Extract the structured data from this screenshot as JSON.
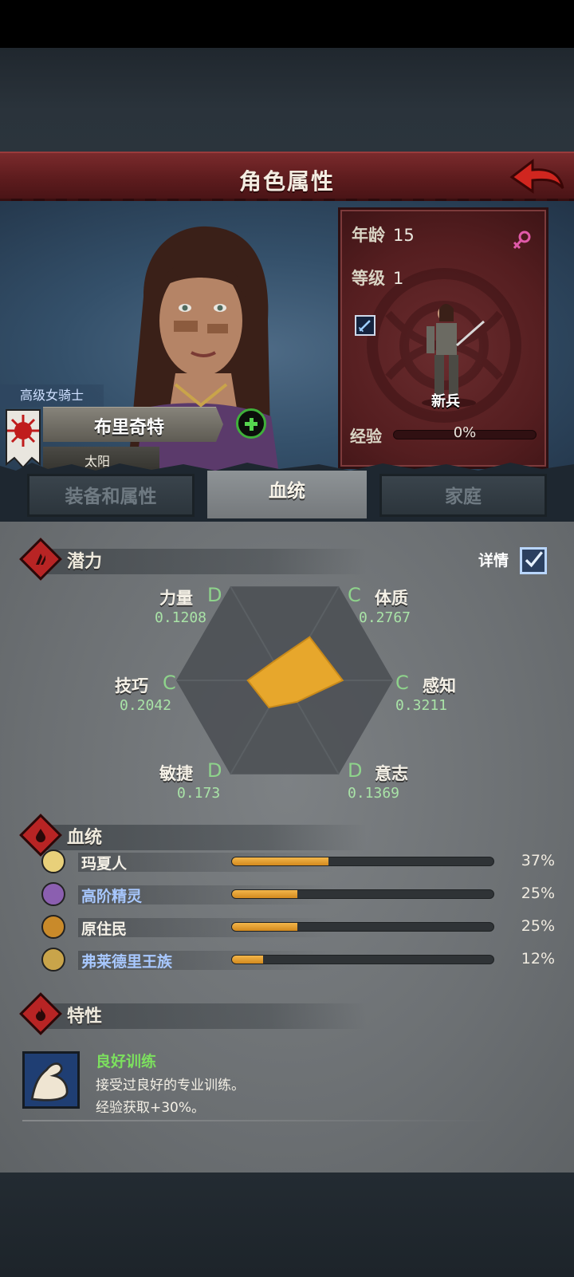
{
  "header": {
    "title": "角色属性"
  },
  "character": {
    "rank_title": "高级女骑士",
    "name": "布里奇特",
    "faction": "太阳"
  },
  "info": {
    "age_label": "年龄",
    "age": "15",
    "level_label": "等级",
    "level": "1",
    "class_name": "新兵",
    "exp_label": "经验",
    "exp_text": "0%",
    "exp_progress": 0.0
  },
  "tabs": [
    {
      "label": "装备和属性",
      "active": false
    },
    {
      "label": "血统",
      "active": true
    },
    {
      "label": "家庭",
      "active": false
    }
  ],
  "potential": {
    "title": "潜力",
    "details_label": "详情",
    "details_checked": true,
    "stats": [
      {
        "name": "力量",
        "grade": "D",
        "value": "0.1208"
      },
      {
        "name": "体质",
        "grade": "C",
        "value": "0.2767"
      },
      {
        "name": "感知",
        "grade": "C",
        "value": "0.3211"
      },
      {
        "name": "意志",
        "grade": "D",
        "value": "0.1369"
      },
      {
        "name": "敏捷",
        "grade": "D",
        "value": "0.173"
      },
      {
        "name": "技巧",
        "grade": "C",
        "value": "0.2042"
      }
    ]
  },
  "bloodline": {
    "title": "血统",
    "items": [
      {
        "name": "玛夏人",
        "percent": "37%",
        "fraction": 0.37,
        "name_color": "#f4f0e6",
        "icon_color": "#e8d07a"
      },
      {
        "name": "高阶精灵",
        "percent": "25%",
        "fraction": 0.25,
        "name_color": "#a8c8ff",
        "icon_color": "#8b5fb0"
      },
      {
        "name": "原住民",
        "percent": "25%",
        "fraction": 0.25,
        "name_color": "#f4f0e6",
        "icon_color": "#c98a2a"
      },
      {
        "name": "弗莱德里王族",
        "percent": "12%",
        "fraction": 0.12,
        "name_color": "#a8c8ff",
        "icon_color": "#c9a44a"
      }
    ]
  },
  "traits": {
    "title": "特性",
    "items": [
      {
        "name": "良好训练",
        "desc_line1": "接受过良好的专业训练。",
        "desc_line2": "经验获取+30%。",
        "icon": "flexed-arm-icon"
      }
    ]
  },
  "colors": {
    "title_red": "#6a2224",
    "radar_fill": "#e7a72c",
    "grade_green": "#8ed38b",
    "lineage_bar": "#e2a22e"
  }
}
